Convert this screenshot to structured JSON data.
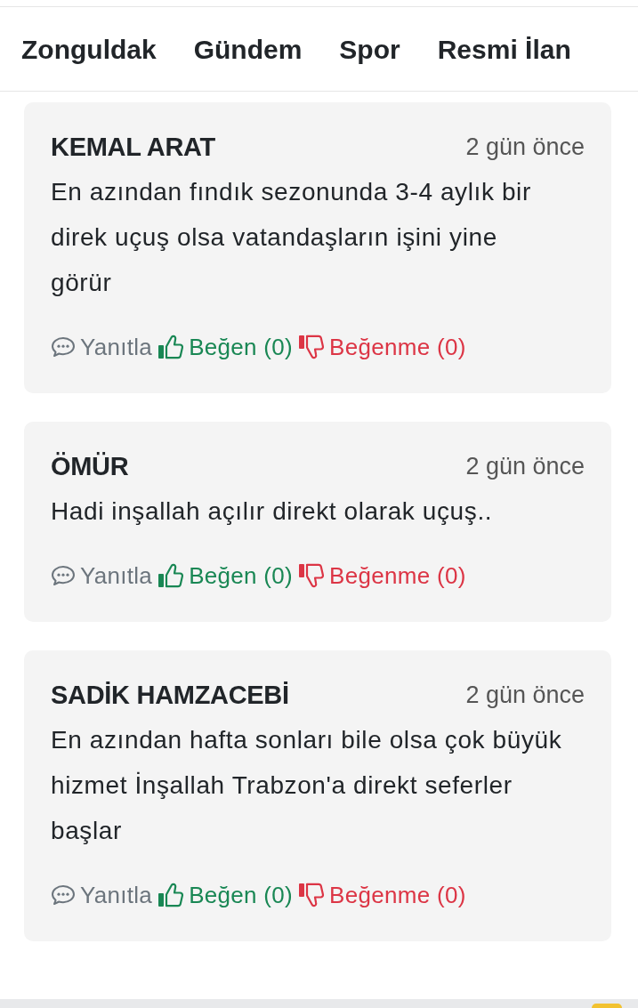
{
  "nav": {
    "items": [
      "Zonguldak",
      "Gündem",
      "Spor",
      "Resmi İlan"
    ]
  },
  "comments": [
    {
      "author": "KEMAL ARAT",
      "time": "2 gün önce",
      "text": "En azından fındık sezonunda 3-4 aylık bir direk uçuş olsa vatandaşların işini yine görür",
      "actions": [
        {
          "kind": "reply",
          "label": "Yanıtla"
        },
        {
          "kind": "like",
          "label": "Beğen (0)"
        },
        {
          "kind": "dislike",
          "label": "Beğenme (0)"
        }
      ]
    },
    {
      "author": "ÖMÜR",
      "time": "2 gün önce",
      "text": "Hadi inşallah açılır direkt olarak uçuş..",
      "actions": [
        {
          "kind": "reply",
          "label": "Yanıtla"
        },
        {
          "kind": "like",
          "label": "Beğen (0)"
        },
        {
          "kind": "dislike",
          "label": "Beğenme (0)"
        }
      ]
    },
    {
      "author": "SADİK HAMZACEBİ",
      "time": "2 gün önce",
      "text": "En azından hafta sonları bile olsa çok büyük hizmet İnşallah Trabzon'a direkt seferler başlar",
      "actions": [
        {
          "kind": "reply",
          "label": "Yanıtla"
        },
        {
          "kind": "like",
          "label": "Beğen (0)"
        },
        {
          "kind": "dislike",
          "label": "Beğenme (0)"
        }
      ]
    }
  ]
}
